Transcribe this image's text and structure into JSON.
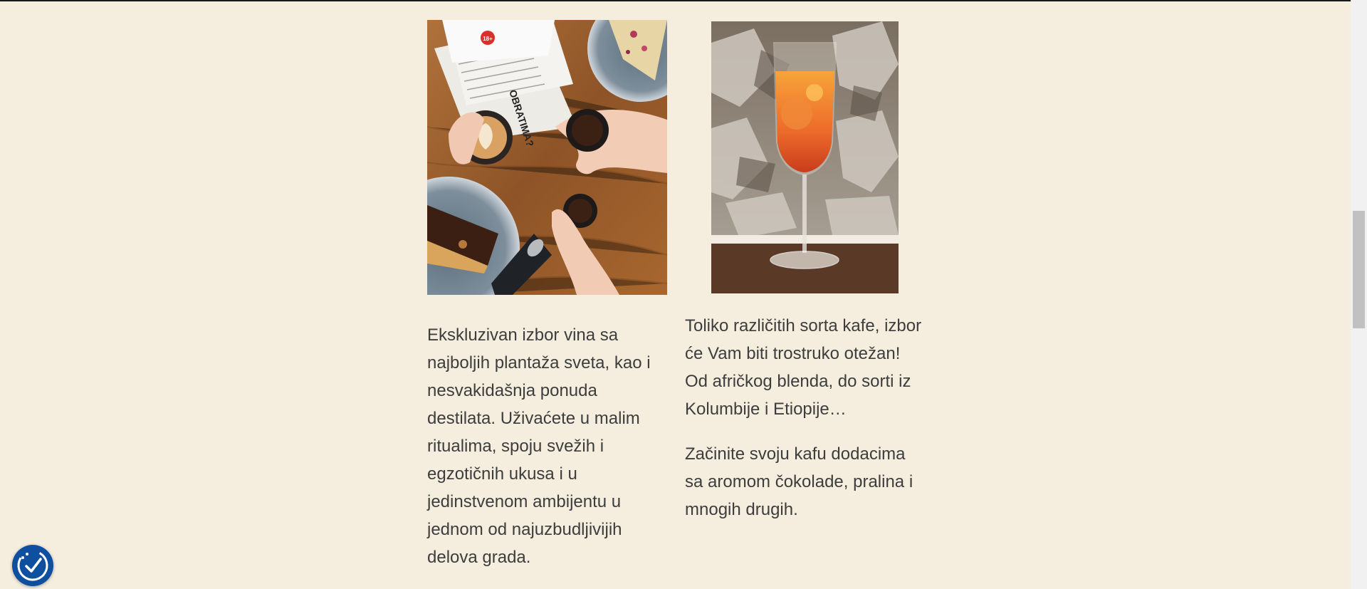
{
  "images": {
    "coffee": {
      "alt": "Ruke sa šoljicama kafe, tortom i novinama na drvenom stolu"
    },
    "spritz": {
      "alt": "Narandžasti koktel u čaši za vino ispred kamenog zida"
    }
  },
  "newspaper_badge": "18+",
  "left_column": {
    "text": "Ekskluzivan izbor vina sa najboljih plantaža sveta, kao i nesvakidašnja ponuda destilata. Uživaćete u malim ritualima, spoju svežih i egzotičnih ukusa i u jedinstvenom ambijentu u jednom od najuzbudljivijih delova grada."
  },
  "right_column": {
    "paragraph_1": "Toliko različitih sorta kafe, izbor će Vam biti trostruko otežan! Od afričkog blenda, do sorti iz Kolumbije i Etiopije…",
    "paragraph_2": "Začinite svoju kafu dodacima sa aromom čokolade, pralina i mnogih drugih."
  },
  "accessibility_button": {
    "icon": "accessibility-checkmark-icon",
    "color": "#0f4fa0"
  },
  "colors": {
    "page_background": "#f5eedf",
    "body_text": "#3d3d3d"
  }
}
